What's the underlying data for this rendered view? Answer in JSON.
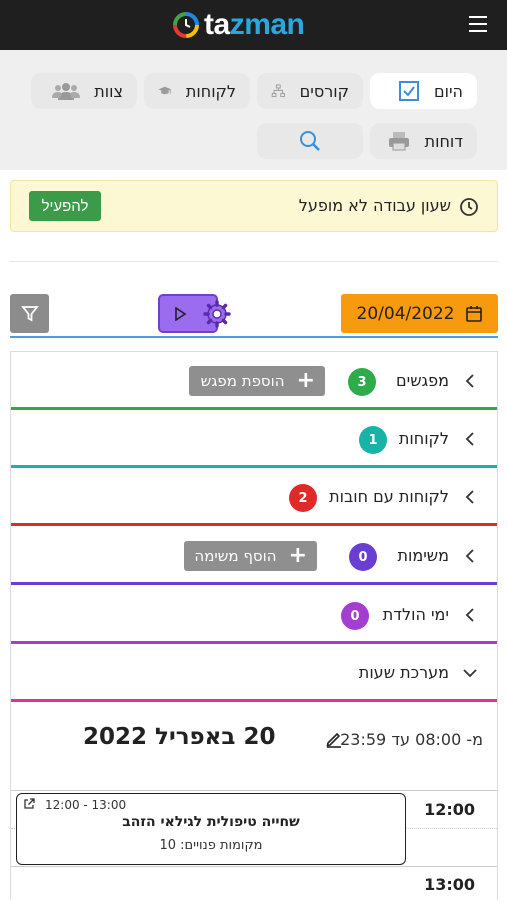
{
  "header": {
    "brand": "tazman",
    "brand_prefix": "ta",
    "brand_rest": "zman"
  },
  "nav": {
    "today": "היום",
    "courses": "קורסים",
    "customers": "לקוחות",
    "team": "צוות",
    "reports": "דוחות"
  },
  "alert": {
    "text": "שעון עבודה לא מופעל",
    "button": "להפעיל"
  },
  "toolbar": {
    "date": "20/04/2022"
  },
  "sections": [
    {
      "label": "מפגשים",
      "count": "3",
      "color": "#2eab4a",
      "add_label": "הוספת מפגש"
    },
    {
      "label": "לקוחות",
      "count": "1",
      "color": "#16b3a6"
    },
    {
      "label": "לקוחות עם חובות",
      "count": "2",
      "color": "#e02a2a"
    },
    {
      "label": "משימות",
      "count": "0",
      "color": "#6a3ed3",
      "add_label": "הוסף משימה"
    },
    {
      "label": "ימי הולדת",
      "count": "0",
      "color": "#a43ed0"
    },
    {
      "label": "מערכת שעות",
      "color": "#e0309a"
    }
  ],
  "schedule": {
    "hours_text": "מ- 08:00 עד 23:59",
    "date_title": "20 באפריל 2022",
    "times": [
      "12:00",
      "13:00"
    ],
    "event": {
      "time": "12:00 - 13:00",
      "title": "שחייה טיפולית לגילאי הזהב",
      "subtitle": "מקומות פנויים: 10"
    }
  }
}
